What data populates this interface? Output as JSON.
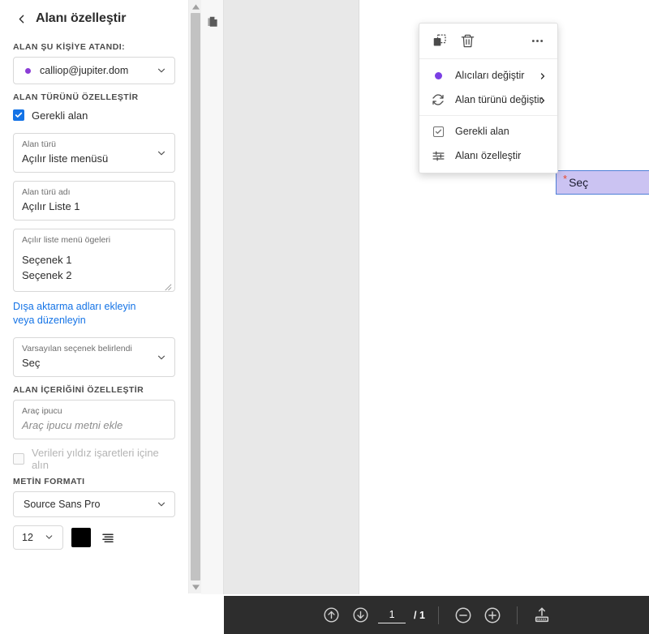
{
  "sidebar": {
    "back_icon": "chevron-left-icon",
    "title": "Alanı özelleştir",
    "assigned_section_label": "ALAN ŞU KİŞİYE ATANDI:",
    "assignee": {
      "email": "calliop@jupiter.dom",
      "dot_color": "#8b3dd6",
      "chevron_icon": "chevron-down-icon"
    },
    "field_type_section_label": "ALAN TÜRÜNÜ ÖZELLEŞTİR",
    "required_field": {
      "label": "Gerekli alan",
      "checked": true,
      "check_color": "#1473e6"
    },
    "field_type": {
      "label": "Alan türü",
      "value": "Açılır liste menüsü",
      "chevron_icon": "chevron-down-icon"
    },
    "field_type_name": {
      "label": "Alan türü adı",
      "value": "Açılır Liste 1"
    },
    "dropdown_items": {
      "label": "Açılır liste menü ögeleri",
      "items": [
        "Seçenek 1",
        "Seçenek 2"
      ],
      "resize_icon": "resize-grip-icon"
    },
    "export_link": "Dışa aktarma adları ekleyin veya düzenleyin",
    "default_option": {
      "label": "Varsayılan seçenek belirlendi",
      "value": "Seç",
      "chevron_icon": "chevron-down-icon"
    },
    "content_section_label": "ALAN İÇERİĞİNİ ÖZELLEŞTİR",
    "tooltip": {
      "label": "Araç ipucu",
      "placeholder": "Araç ipucu metni ekle"
    },
    "asterisk_option": {
      "label": "Verileri yıldız işaretleri içine alın",
      "checked": false,
      "disabled": true
    },
    "text_format_section_label": "METİN FORMATI",
    "font_family": {
      "value": "Source Sans Pro",
      "chevron_icon": "chevron-down-icon"
    },
    "font_size": {
      "value": "12",
      "chevron_icon": "chevron-down-icon"
    },
    "font_color": "#000000",
    "align_icon": "text-align-icon"
  },
  "scrollbar": {
    "up_icon": "scroll-up-arrow-icon",
    "down_icon": "scroll-down-arrow-icon"
  },
  "rail": {
    "pages_icon": "page-thumbnails-icon"
  },
  "document": {
    "form_field": {
      "required_marker": "*",
      "value": "Seç",
      "chevron_icon": "chevron-down-icon",
      "fill_color": "#cbc3f2",
      "border_color": "#4f7fd6"
    }
  },
  "context_menu": {
    "tools": [
      {
        "name": "duplicate-icon",
        "label": "Çoğalt"
      },
      {
        "name": "delete-icon",
        "label": "Sil"
      },
      {
        "name": "more-options-icon",
        "label": "Diğer"
      }
    ],
    "items": [
      {
        "label": "Alıcıları değiştir",
        "icon": "recipient-dot-icon",
        "has_submenu": true
      },
      {
        "label": "Alan türünü değiştir",
        "icon": "refresh-icon",
        "has_submenu": true
      },
      {
        "label": "Gerekli alan",
        "icon": "checkbox-icon",
        "has_submenu": false,
        "checked": true
      },
      {
        "label": "Alanı özelleştir",
        "icon": "sliders-icon",
        "has_submenu": false
      }
    ]
  },
  "bottom_bar": {
    "prev_page_icon": "arrow-up-circle-icon",
    "next_page_icon": "arrow-down-circle-icon",
    "current_page": "1",
    "page_separator": "/ 1",
    "zoom_out_icon": "zoom-out-icon",
    "zoom_in_icon": "zoom-in-icon",
    "upload_icon": "upload-signature-icon"
  }
}
